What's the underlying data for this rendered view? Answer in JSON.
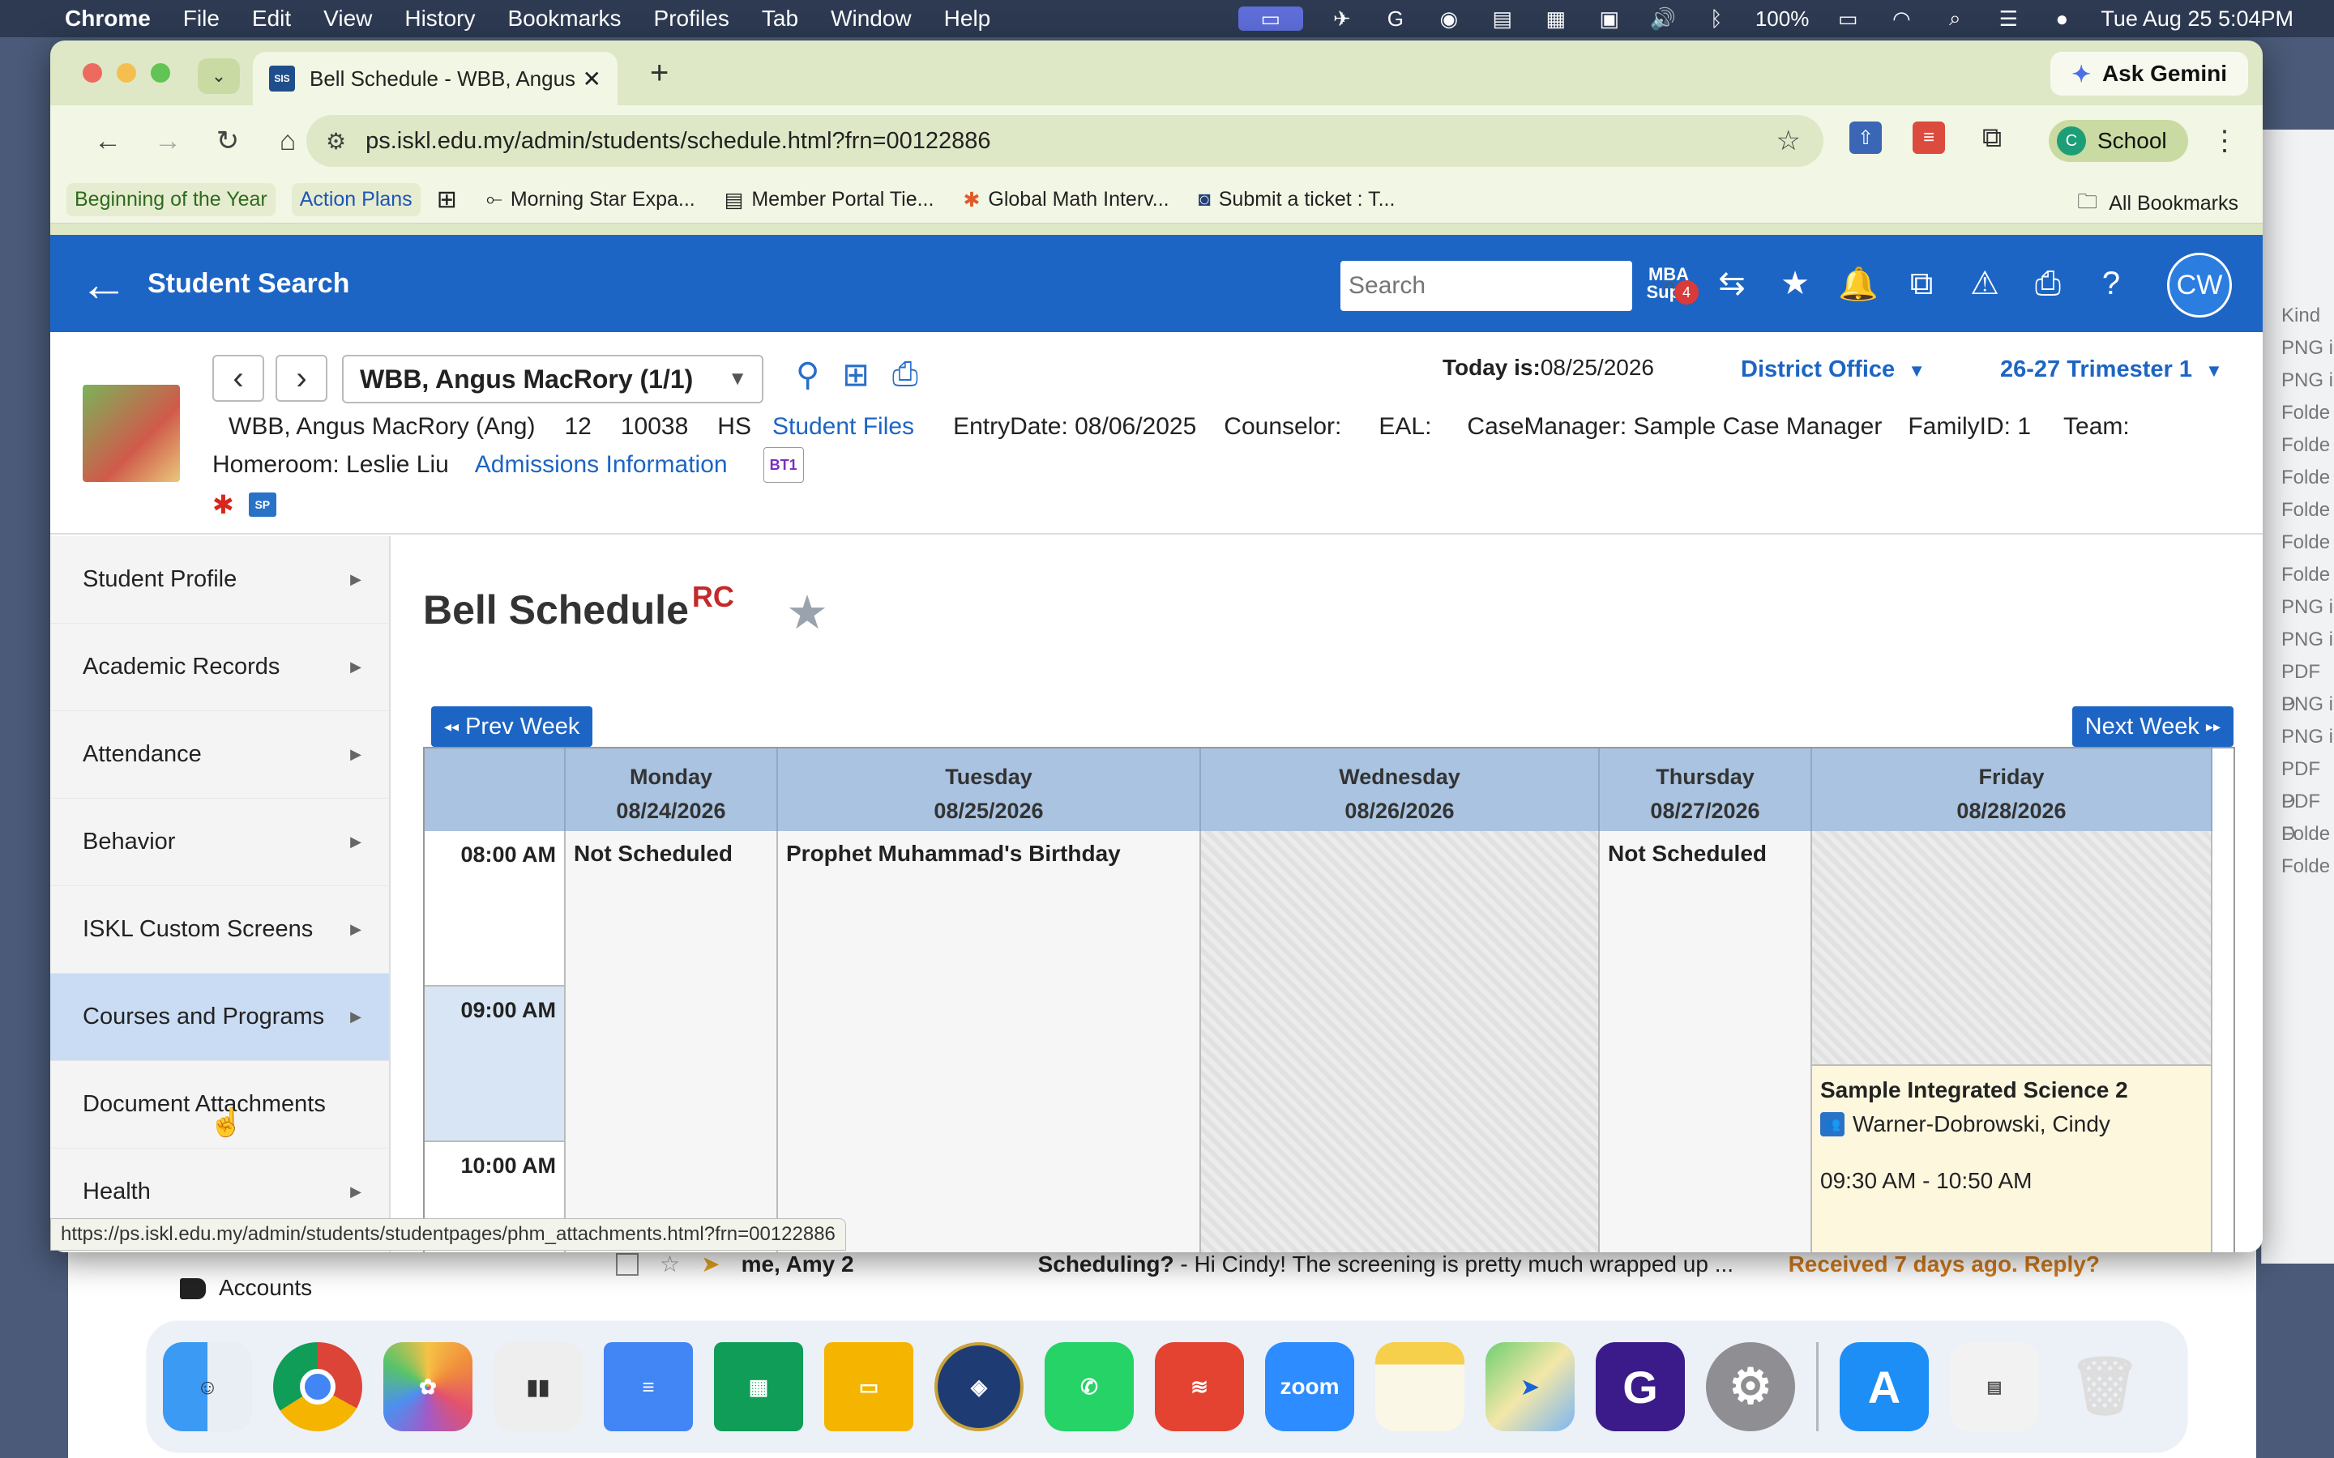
{
  "menubar": {
    "app": "Chrome",
    "items": [
      "File",
      "Edit",
      "View",
      "History",
      "Bookmarks",
      "Profiles",
      "Tab",
      "Window",
      "Help"
    ],
    "battery": "100%",
    "datetime": "Tue Aug 25  5:04PM"
  },
  "browser": {
    "tab_title": "Bell Schedule - WBB, Angus MacRory",
    "tab_favicon": "SIS",
    "ask_gemini": "Ask Gemini",
    "url": "ps.iskl.edu.my/admin/students/schedule.html?frn=00122886",
    "profile_initial": "C",
    "profile_name": "School",
    "bookmarks": [
      "Beginning of the Year",
      "Action Plans",
      "Morning Star Expa...",
      "Member Portal Tie...",
      "Global Math Interv...",
      "Submit a ticket : T..."
    ],
    "all_bookmarks": "All Bookmarks",
    "status_url": "https://ps.iskl.edu.my/admin/students/studentpages/phm_attachments.html?frn=00122886"
  },
  "ps": {
    "header_title": "Student Search",
    "search_placeholder": "Search",
    "mba_label": "MBA",
    "mba_sub": "Supp",
    "mba_badge": "4",
    "user_initials": "CW"
  },
  "student": {
    "select_label": "WBB, Angus MacRory  (1/1)",
    "today_label": "Today is:",
    "today_value": "08/25/2026",
    "district": "District Office",
    "term": "26-27 Trimester 1",
    "name_full": "WBB, Angus MacRory (Ang)",
    "grade": "12",
    "student_number": "10038",
    "school": "HS",
    "student_files": "Student Files",
    "entry_date": "EntryDate: 08/06/2025",
    "counselor": "Counselor:",
    "eal": "EAL:",
    "case_manager": "CaseManager: Sample Case Manager",
    "family_id": "FamilyID: 1",
    "team": "Team:",
    "homeroom": "Homeroom: Leslie Liu",
    "admissions": "Admissions Information",
    "bt1": "BT1",
    "sp": "SP"
  },
  "sidenav": [
    {
      "label": "Student Profile"
    },
    {
      "label": "Academic Records"
    },
    {
      "label": "Attendance"
    },
    {
      "label": "Behavior"
    },
    {
      "label": "ISKL Custom Screens"
    },
    {
      "label": "Courses and Programs"
    },
    {
      "label": "Document Attachments"
    },
    {
      "label": "Health"
    }
  ],
  "schedule": {
    "title": "Bell Schedule",
    "rc": "RC",
    "prev_week": "Prev Week",
    "next_week": "Next Week",
    "days": [
      {
        "name": "Monday",
        "date": "08/24/2026"
      },
      {
        "name": "Tuesday",
        "date": "08/25/2026"
      },
      {
        "name": "Wednesday",
        "date": "08/26/2026"
      },
      {
        "name": "Thursday",
        "date": "08/27/2026"
      },
      {
        "name": "Friday",
        "date": "08/28/2026"
      }
    ],
    "times": [
      "08:00 AM",
      "09:00 AM",
      "10:00 AM"
    ],
    "monday_event": "Not Scheduled",
    "tuesday_event": "Prophet Muhammad's Birthday",
    "thursday_event": "Not Scheduled",
    "friday_class": {
      "course": "Sample Integrated Science 2",
      "teacher": "Warner-Dobrowski, Cindy",
      "time": "09:30 AM - 10:50 AM"
    }
  },
  "background": {
    "gmail_label": "Accounts",
    "email_from": "me, Amy 2",
    "email_subject": "Scheduling?",
    "email_snippet": " - Hi Cindy! The screening is pretty much wrapped up ...",
    "email_nudge": "Received 7 days ago. Reply?",
    "finder_header": "Kind",
    "finder_rows": [
      "PNG i",
      "PNG i",
      "Folde",
      "Folde",
      "Folde",
      "Folde",
      "Folde",
      "Folde",
      "PNG i",
      "PNG i",
      "PDF D",
      "PNG i",
      "PNG i",
      "PDF D",
      "PDF D",
      "Folde",
      "Folde"
    ]
  },
  "dock": {
    "zoom": "zoom"
  }
}
